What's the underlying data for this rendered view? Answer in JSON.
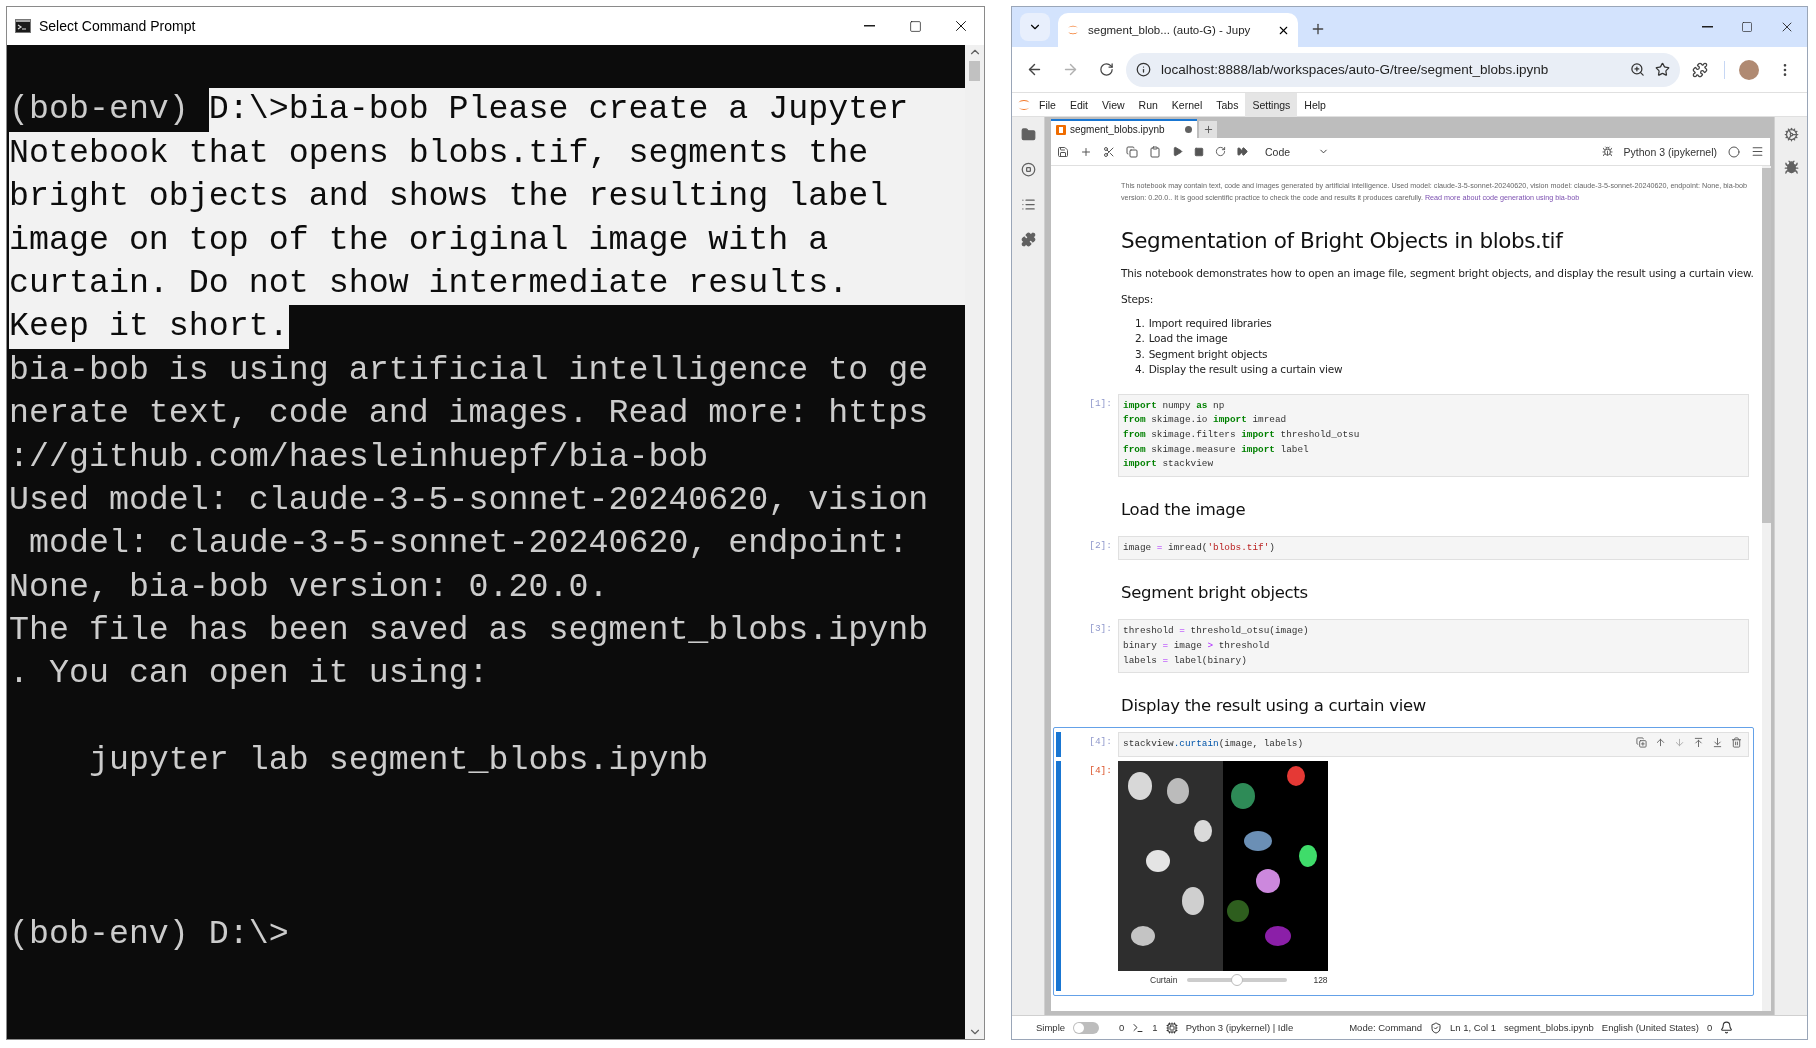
{
  "terminal": {
    "title": "Select Command Prompt",
    "lines": [
      {
        "kind": "blank"
      },
      {
        "kind": "text",
        "to_edge": true,
        "segments": [
          {
            "text": "(bob-env) ",
            "selected": false
          },
          {
            "text": "D:\\>bia-bob Please create a Jupyter",
            "selected": true
          }
        ]
      },
      {
        "kind": "text",
        "to_edge": true,
        "segments": [
          {
            "text": "Notebook that opens blobs.tif, segments the",
            "selected": true
          }
        ]
      },
      {
        "kind": "text",
        "to_edge": true,
        "segments": [
          {
            "text": "bright objects and shows the resulting label",
            "selected": true
          }
        ]
      },
      {
        "kind": "text",
        "to_edge": true,
        "segments": [
          {
            "text": "image on top of the original image with a",
            "selected": true
          }
        ]
      },
      {
        "kind": "text",
        "to_edge": true,
        "segments": [
          {
            "text": "curtain. Do not show intermediate results.",
            "selected": true
          }
        ]
      },
      {
        "kind": "text",
        "to_edge": false,
        "segments": [
          {
            "text": "Keep it short.",
            "selected": true
          }
        ]
      },
      {
        "kind": "text",
        "segments": [
          {
            "text": "bia-bob is using artificial intelligence to ge",
            "selected": false
          }
        ]
      },
      {
        "kind": "text",
        "segments": [
          {
            "text": "nerate text, code and images. Read more: https",
            "selected": false
          }
        ]
      },
      {
        "kind": "text",
        "segments": [
          {
            "text": "://github.com/haesleinhuepf/bia-bob",
            "selected": false
          }
        ]
      },
      {
        "kind": "text",
        "segments": [
          {
            "text": "Used model: claude-3-5-sonnet-20240620, vision",
            "selected": false
          }
        ]
      },
      {
        "kind": "text",
        "segments": [
          {
            "text": " model: claude-3-5-sonnet-20240620, endpoint:",
            "selected": false
          }
        ]
      },
      {
        "kind": "text",
        "segments": [
          {
            "text": "None, bia-bob version: 0.20.0.",
            "selected": false
          }
        ]
      },
      {
        "kind": "text",
        "segments": [
          {
            "text": "The file has been saved as segment_blobs.ipynb",
            "selected": false
          }
        ]
      },
      {
        "kind": "text",
        "segments": [
          {
            "text": ". You can open it using:",
            "selected": false
          }
        ]
      },
      {
        "kind": "blank"
      },
      {
        "kind": "text",
        "segments": [
          {
            "text": "    jupyter lab segment_blobs.ipynb",
            "selected": false
          }
        ]
      },
      {
        "kind": "blank"
      },
      {
        "kind": "blank"
      },
      {
        "kind": "blank"
      },
      {
        "kind": "text",
        "segments": [
          {
            "text": "(bob-env) D:\\>",
            "selected": false
          }
        ]
      }
    ]
  },
  "browser": {
    "tab_title": "segment_blob... (auto-G) - Jupy",
    "address": "localhost:8888/lab/workspaces/auto-G/tree/segment_blobs.ipynb"
  },
  "jupyter": {
    "menu": [
      {
        "label": "File",
        "selected": false
      },
      {
        "label": "Edit",
        "selected": false
      },
      {
        "label": "View",
        "selected": false
      },
      {
        "label": "Run",
        "selected": false
      },
      {
        "label": "Kernel",
        "selected": false
      },
      {
        "label": "Tabs",
        "selected": false
      },
      {
        "label": "Settings",
        "selected": true
      },
      {
        "label": "Help",
        "selected": false
      }
    ],
    "document_tab": {
      "label": "segment_blobs.ipynb",
      "modified": true
    },
    "toolbar": {
      "cell_type": "Code",
      "kernel": "Python 3 (ipykernel)"
    },
    "cells": [
      {
        "kind": "note",
        "text": "This notebook may contain text, code and images generated by artificial intelligence. Used model: claude-3-5-sonnet-20240620, vision model: claude-3-5-sonnet-20240620, endpoint: None, bia-bob version: 0.20.0.. It is good scientific practice to check the code and results it produces carefully.",
        "link": "Read more about code generation using bia-bob"
      },
      {
        "kind": "h1",
        "text": "Segmentation of Bright Objects in blobs.tif"
      },
      {
        "kind": "p",
        "text": "This notebook demonstrates how to open an image file, segment bright objects, and display the result using a curtain view."
      },
      {
        "kind": "p",
        "text": "Steps:"
      },
      {
        "kind": "ol",
        "items": [
          {
            "number": "1.",
            "text": "Import required libraries"
          },
          {
            "number": "2.",
            "text": "Load the image"
          },
          {
            "number": "3.",
            "text": "Segment bright objects"
          },
          {
            "number": "4.",
            "text": "Display the result using a curtain view"
          }
        ]
      },
      {
        "kind": "code",
        "prompt": "[1]:",
        "selected": false,
        "lines": [
          [
            {
              "kind": "kw",
              "text": "import"
            },
            {
              "kind": "plain",
              "text": " numpy "
            },
            {
              "kind": "kw",
              "text": "as"
            },
            {
              "kind": "plain",
              "text": " np"
            }
          ],
          [
            {
              "kind": "kw",
              "text": "from"
            },
            {
              "kind": "plain",
              "text": " skimage.io "
            },
            {
              "kind": "kw",
              "text": "import"
            },
            {
              "kind": "plain",
              "text": " imread"
            }
          ],
          [
            {
              "kind": "kw",
              "text": "from"
            },
            {
              "kind": "plain",
              "text": " skimage.filters "
            },
            {
              "kind": "kw",
              "text": "import"
            },
            {
              "kind": "plain",
              "text": " threshold_otsu"
            }
          ],
          [
            {
              "kind": "kw",
              "text": "from"
            },
            {
              "kind": "plain",
              "text": " skimage.measure "
            },
            {
              "kind": "kw",
              "text": "import"
            },
            {
              "kind": "plain",
              "text": " label"
            }
          ],
          [
            {
              "kind": "kw",
              "text": "import"
            },
            {
              "kind": "plain",
              "text": " stackview"
            }
          ]
        ]
      },
      {
        "kind": "h2",
        "text": "Load the image"
      },
      {
        "kind": "code",
        "prompt": "[2]:",
        "selected": false,
        "lines": [
          [
            {
              "kind": "plain",
              "text": "image "
            },
            {
              "kind": "op",
              "text": "="
            },
            {
              "kind": "plain",
              "text": " imread("
            },
            {
              "kind": "str",
              "text": "'blobs.tif'"
            },
            {
              "kind": "plain",
              "text": ")"
            }
          ]
        ]
      },
      {
        "kind": "h2",
        "text": "Segment bright objects"
      },
      {
        "kind": "code",
        "prompt": "[3]:",
        "selected": false,
        "lines": [
          [
            {
              "kind": "plain",
              "text": "threshold "
            },
            {
              "kind": "op",
              "text": "="
            },
            {
              "kind": "plain",
              "text": " threshold_otsu(image)"
            }
          ],
          [
            {
              "kind": "plain",
              "text": "binary "
            },
            {
              "kind": "op",
              "text": "="
            },
            {
              "kind": "plain",
              "text": " image "
            },
            {
              "kind": "op",
              "text": ">"
            },
            {
              "kind": "plain",
              "text": " threshold"
            }
          ],
          [
            {
              "kind": "plain",
              "text": "labels "
            },
            {
              "kind": "op",
              "text": "="
            },
            {
              "kind": "plain",
              "text": " label(binary)"
            }
          ]
        ]
      },
      {
        "kind": "h2",
        "text": "Display the result using a curtain view"
      },
      {
        "kind": "code",
        "prompt": "[4]:",
        "selected": true,
        "lines": [
          [
            {
              "kind": "plain",
              "text": "stackview"
            },
            {
              "kind": "attr",
              "text": ".curtain"
            },
            {
              "kind": "plain",
              "text": "(image, labels)"
            }
          ]
        ],
        "output": {
          "prompt": "[4]:",
          "kind": "picture",
          "slider": {
            "label": "Curtain",
            "level": 0.5,
            "reading": "128"
          }
        }
      }
    ],
    "status_bar": {
      "simple_label": "Simple",
      "simple_on": false,
      "terminals": "0",
      "kernels": "1",
      "kernel_status": "Python 3 (ipykernel) | Idle",
      "mode": "Mode: Command",
      "cursor": "Ln 1, Col 1",
      "file": "segment_blobs.ipynb",
      "language": "English (United States)",
      "notifications": "0"
    }
  }
}
